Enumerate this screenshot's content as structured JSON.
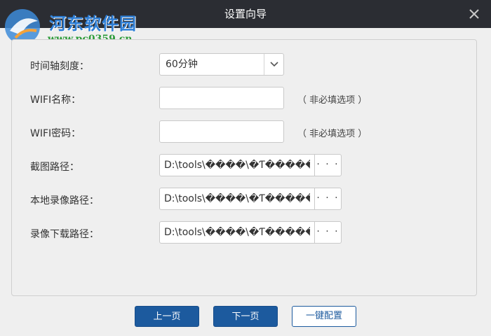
{
  "window": {
    "title": "设置向导",
    "close_icon": "close-icon"
  },
  "watermark": {
    "site_name": "河东软件园",
    "url": "www.pc0359.cn"
  },
  "form": {
    "timeline_scale": {
      "label": "时间轴刻度：",
      "value": "60分钟",
      "arrow_icon": "chevron-down-icon"
    },
    "wifi_name": {
      "label": "WIFI名称：",
      "value": "",
      "hint": "（ 非必填选项 ）"
    },
    "wifi_password": {
      "label": "WIFI密码：",
      "value": "",
      "hint": "（ 非必填选项 ）"
    },
    "screenshot_path": {
      "label": "截图路径：",
      "value": "D:\\tools\\����\\�Ƭ�����",
      "browse_label": "· · ·"
    },
    "local_record_path": {
      "label": "本地录像路径：",
      "value": "D:\\tools\\����\\�Ƭ�����",
      "browse_label": "· · ·"
    },
    "record_download_path": {
      "label": "录像下载路径：",
      "value": "D:\\tools\\����\\�Ƭ�����",
      "browse_label": "· · ·"
    }
  },
  "footer": {
    "prev_label": "上一页",
    "next_label": "下一页",
    "one_click_label": "一键配置"
  },
  "colors": {
    "titlebar": "#2b2d33",
    "primary": "#1c5a9e",
    "background": "#efefef"
  }
}
